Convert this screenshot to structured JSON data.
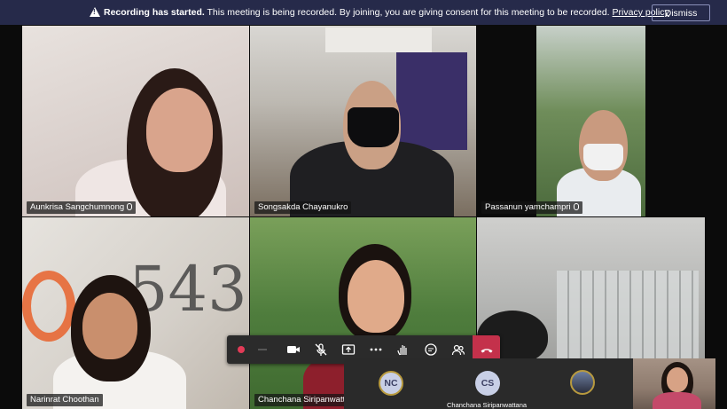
{
  "banner": {
    "title": "Recording has started.",
    "message": "This meeting is being recorded. By joining, you are giving consent for this meeting to be recorded.",
    "link": "Privacy policy",
    "dismiss": "Dismiss"
  },
  "participants": [
    {
      "name": "Aunkrisa Sangchumnong",
      "mic": "mic-icon"
    },
    {
      "name": "Songsakda Chayanukro"
    },
    {
      "name": "Passanun yamchampri",
      "mic": "mic-icon"
    },
    {
      "name": "Narinrat Choothan"
    },
    {
      "name": "Chanchana Siripanwatta"
    },
    {
      "name": ""
    }
  ],
  "strip": {
    "avatars": [
      {
        "initials": "NC"
      },
      {
        "initials": "CS",
        "name": "Chanchana Siripanwattana"
      }
    ]
  },
  "controls": [
    "record-icon",
    "blur-icon",
    "camera-icon",
    "mic-off-icon",
    "share-icon",
    "more-icon",
    "raise-hand-icon",
    "chat-icon",
    "participants-icon",
    "hangup-icon"
  ],
  "colors": {
    "banner": "#262a4a",
    "hangup": "#c4314b",
    "avatar_bg": "#c8cfe6"
  }
}
